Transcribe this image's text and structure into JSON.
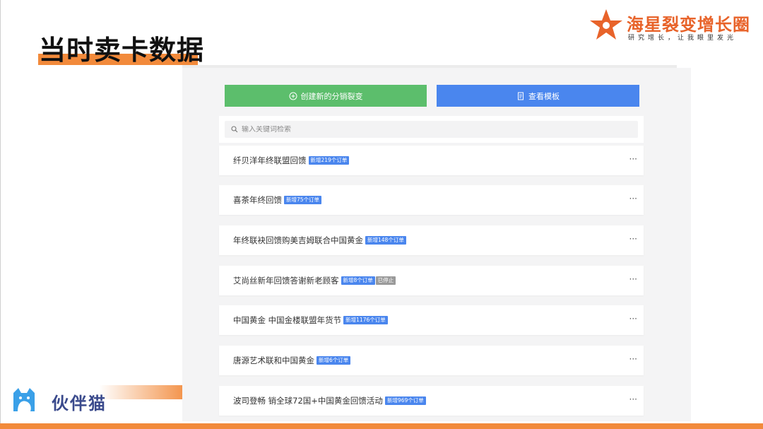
{
  "slide": {
    "title": "当时卖卡数据"
  },
  "brand": {
    "name": "海星裂变增长圈",
    "slogan": "研究增长，让我眼里发光"
  },
  "toolbar": {
    "create_label": "创建新的分销裂变",
    "template_label": "查看模板"
  },
  "search": {
    "placeholder": "输入关键词检索"
  },
  "campaigns": [
    {
      "title": "纤贝洋年终联盟回馈",
      "badge": "新增219个订单"
    },
    {
      "title": "喜茶年终回馈",
      "badge": "新增75个订单"
    },
    {
      "title": "年终联袂回馈购美吉姆联合中国黄金",
      "badge": "新增148个订单"
    },
    {
      "title": "艾尚丝新年回馈答谢新老顾客",
      "badge": "新增8个订单",
      "status": "已停止"
    },
    {
      "title": "中国黄金 中国金楼联盟年货节",
      "badge": "新增1176个订单"
    },
    {
      "title": "唐源艺术联和中国黄金",
      "badge": "新增6个订单"
    },
    {
      "title": "波司登畅 销全球72国+中国黄金回馈活动",
      "badge": "新增969个订单"
    }
  ],
  "more_label": "···",
  "footer": {
    "brand_text": "伙伴猫"
  },
  "colors": {
    "accent_orange": "#f28a3b",
    "create_green": "#5cbe6c",
    "template_blue": "#4a86ee",
    "badge_blue": "#4a86ee",
    "status_gray": "#9a9a9a"
  }
}
